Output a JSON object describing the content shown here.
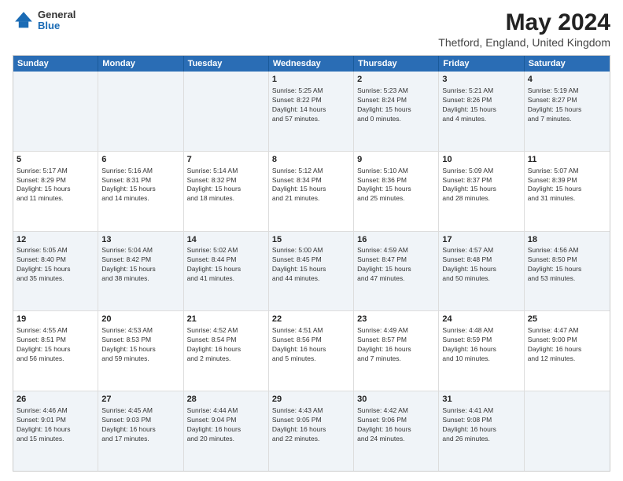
{
  "header": {
    "logo": {
      "general": "General",
      "blue": "Blue"
    },
    "title": "May 2024",
    "subtitle": "Thetford, England, United Kingdom"
  },
  "days": [
    "Sunday",
    "Monday",
    "Tuesday",
    "Wednesday",
    "Thursday",
    "Friday",
    "Saturday"
  ],
  "rows": [
    [
      {
        "day": "",
        "text": ""
      },
      {
        "day": "",
        "text": ""
      },
      {
        "day": "",
        "text": ""
      },
      {
        "day": "1",
        "text": "Sunrise: 5:25 AM\nSunset: 8:22 PM\nDaylight: 14 hours\nand 57 minutes."
      },
      {
        "day": "2",
        "text": "Sunrise: 5:23 AM\nSunset: 8:24 PM\nDaylight: 15 hours\nand 0 minutes."
      },
      {
        "day": "3",
        "text": "Sunrise: 5:21 AM\nSunset: 8:26 PM\nDaylight: 15 hours\nand 4 minutes."
      },
      {
        "day": "4",
        "text": "Sunrise: 5:19 AM\nSunset: 8:27 PM\nDaylight: 15 hours\nand 7 minutes."
      }
    ],
    [
      {
        "day": "5",
        "text": "Sunrise: 5:17 AM\nSunset: 8:29 PM\nDaylight: 15 hours\nand 11 minutes."
      },
      {
        "day": "6",
        "text": "Sunrise: 5:16 AM\nSunset: 8:31 PM\nDaylight: 15 hours\nand 14 minutes."
      },
      {
        "day": "7",
        "text": "Sunrise: 5:14 AM\nSunset: 8:32 PM\nDaylight: 15 hours\nand 18 minutes."
      },
      {
        "day": "8",
        "text": "Sunrise: 5:12 AM\nSunset: 8:34 PM\nDaylight: 15 hours\nand 21 minutes."
      },
      {
        "day": "9",
        "text": "Sunrise: 5:10 AM\nSunset: 8:36 PM\nDaylight: 15 hours\nand 25 minutes."
      },
      {
        "day": "10",
        "text": "Sunrise: 5:09 AM\nSunset: 8:37 PM\nDaylight: 15 hours\nand 28 minutes."
      },
      {
        "day": "11",
        "text": "Sunrise: 5:07 AM\nSunset: 8:39 PM\nDaylight: 15 hours\nand 31 minutes."
      }
    ],
    [
      {
        "day": "12",
        "text": "Sunrise: 5:05 AM\nSunset: 8:40 PM\nDaylight: 15 hours\nand 35 minutes."
      },
      {
        "day": "13",
        "text": "Sunrise: 5:04 AM\nSunset: 8:42 PM\nDaylight: 15 hours\nand 38 minutes."
      },
      {
        "day": "14",
        "text": "Sunrise: 5:02 AM\nSunset: 8:44 PM\nDaylight: 15 hours\nand 41 minutes."
      },
      {
        "day": "15",
        "text": "Sunrise: 5:00 AM\nSunset: 8:45 PM\nDaylight: 15 hours\nand 44 minutes."
      },
      {
        "day": "16",
        "text": "Sunrise: 4:59 AM\nSunset: 8:47 PM\nDaylight: 15 hours\nand 47 minutes."
      },
      {
        "day": "17",
        "text": "Sunrise: 4:57 AM\nSunset: 8:48 PM\nDaylight: 15 hours\nand 50 minutes."
      },
      {
        "day": "18",
        "text": "Sunrise: 4:56 AM\nSunset: 8:50 PM\nDaylight: 15 hours\nand 53 minutes."
      }
    ],
    [
      {
        "day": "19",
        "text": "Sunrise: 4:55 AM\nSunset: 8:51 PM\nDaylight: 15 hours\nand 56 minutes."
      },
      {
        "day": "20",
        "text": "Sunrise: 4:53 AM\nSunset: 8:53 PM\nDaylight: 15 hours\nand 59 minutes."
      },
      {
        "day": "21",
        "text": "Sunrise: 4:52 AM\nSunset: 8:54 PM\nDaylight: 16 hours\nand 2 minutes."
      },
      {
        "day": "22",
        "text": "Sunrise: 4:51 AM\nSunset: 8:56 PM\nDaylight: 16 hours\nand 5 minutes."
      },
      {
        "day": "23",
        "text": "Sunrise: 4:49 AM\nSunset: 8:57 PM\nDaylight: 16 hours\nand 7 minutes."
      },
      {
        "day": "24",
        "text": "Sunrise: 4:48 AM\nSunset: 8:59 PM\nDaylight: 16 hours\nand 10 minutes."
      },
      {
        "day": "25",
        "text": "Sunrise: 4:47 AM\nSunset: 9:00 PM\nDaylight: 16 hours\nand 12 minutes."
      }
    ],
    [
      {
        "day": "26",
        "text": "Sunrise: 4:46 AM\nSunset: 9:01 PM\nDaylight: 16 hours\nand 15 minutes."
      },
      {
        "day": "27",
        "text": "Sunrise: 4:45 AM\nSunset: 9:03 PM\nDaylight: 16 hours\nand 17 minutes."
      },
      {
        "day": "28",
        "text": "Sunrise: 4:44 AM\nSunset: 9:04 PM\nDaylight: 16 hours\nand 20 minutes."
      },
      {
        "day": "29",
        "text": "Sunrise: 4:43 AM\nSunset: 9:05 PM\nDaylight: 16 hours\nand 22 minutes."
      },
      {
        "day": "30",
        "text": "Sunrise: 4:42 AM\nSunset: 9:06 PM\nDaylight: 16 hours\nand 24 minutes."
      },
      {
        "day": "31",
        "text": "Sunrise: 4:41 AM\nSunset: 9:08 PM\nDaylight: 16 hours\nand 26 minutes."
      },
      {
        "day": "",
        "text": ""
      }
    ]
  ],
  "alt_rows": [
    0,
    2,
    4
  ]
}
